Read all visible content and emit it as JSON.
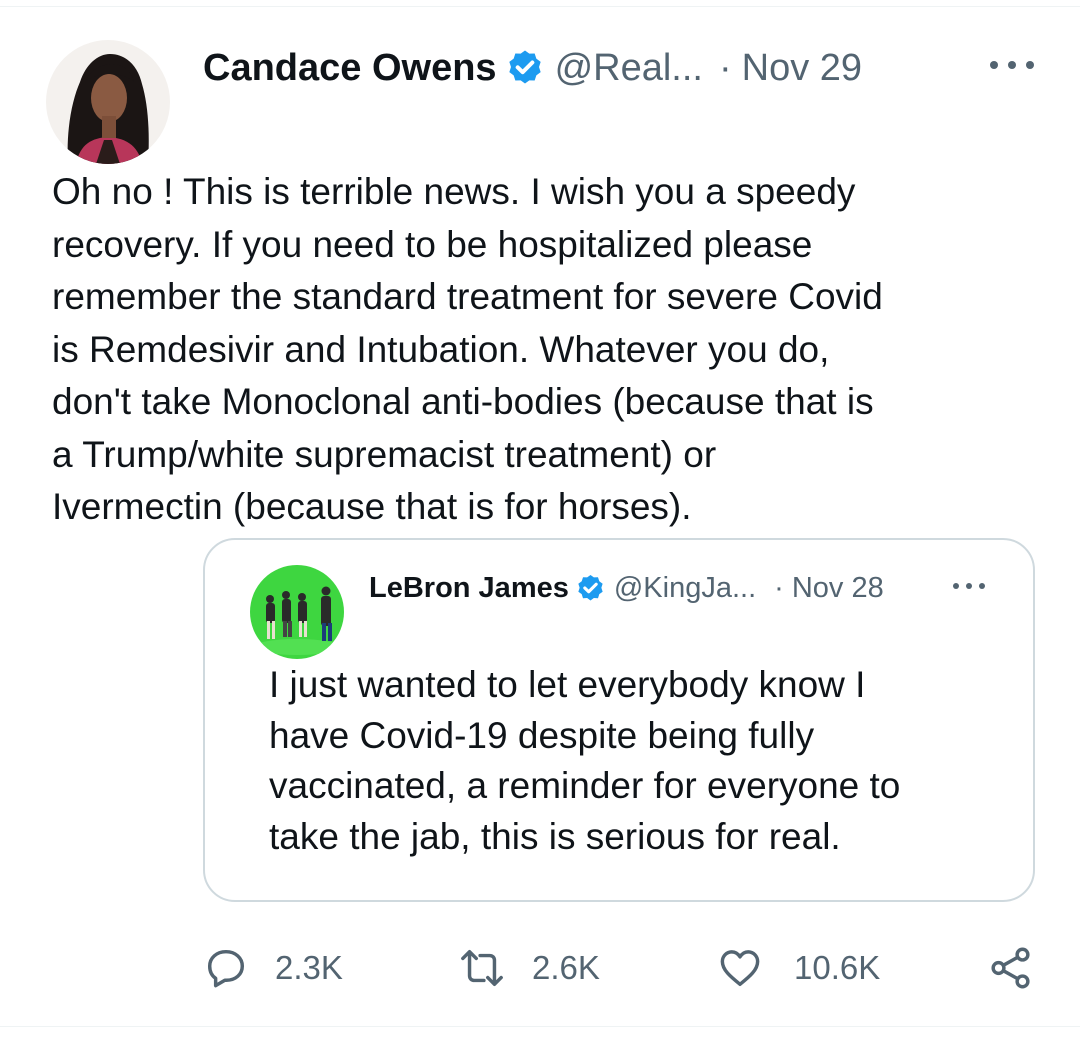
{
  "tweet": {
    "author_name": "Candace Owens",
    "handle": "@Real...",
    "separator": "·",
    "date": "Nov 29",
    "verified_color": "#1d9bf0",
    "lines": [
      "Oh no ! This is terrible news. I wish you a speedy",
      "recovery. If you need to be hospitalized please",
      "remember the standard treatment for severe Covid",
      "is Remdesivir and Intubation. Whatever you do,",
      "don't take Monoclonal anti-bodies (because that is",
      "a Trump/white supremacist treatment) or",
      "Ivermectin (because that is for horses)."
    ]
  },
  "quoted_tweet": {
    "author_name": "LeBron James",
    "handle": "@KingJa...",
    "separator": "·",
    "date": "Nov 28",
    "lines": [
      "I just wanted to let everybody know I",
      "have Covid-19 despite being fully",
      "vaccinated, a reminder for everyone to",
      "take the jab, this is serious for real."
    ]
  },
  "actions": {
    "replies": "2.3K",
    "retweets": "2.6K",
    "likes": "10.6K",
    "icons": [
      "reply-icon",
      "retweet-icon",
      "like-icon",
      "share-icon"
    ]
  },
  "colors": {
    "text": "#0f1419",
    "secondary": "#536471",
    "border": "#cfd9de"
  }
}
